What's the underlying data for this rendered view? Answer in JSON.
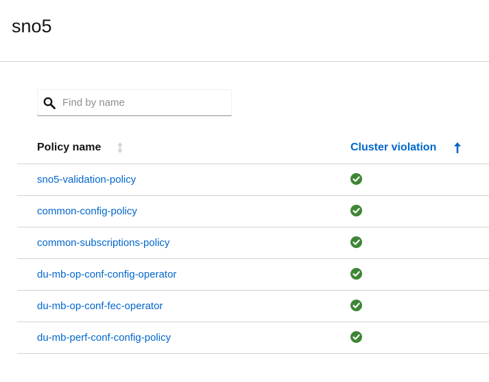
{
  "header": {
    "title": "sno5"
  },
  "search": {
    "placeholder": "Find by name",
    "value": ""
  },
  "table": {
    "columns": [
      {
        "label": "Policy name",
        "sorted": false,
        "sort_icon": "sort-both-icon"
      },
      {
        "label": "Cluster violation",
        "sorted": true,
        "sort_direction": "ascending",
        "sort_icon": "arrow-up-icon"
      }
    ],
    "rows": [
      {
        "policy_name": "sno5-validation-policy",
        "violation_status": "compliant",
        "status_icon": "check-circle-icon"
      },
      {
        "policy_name": "common-config-policy",
        "violation_status": "compliant",
        "status_icon": "check-circle-icon"
      },
      {
        "policy_name": "common-subscriptions-policy",
        "violation_status": "compliant",
        "status_icon": "check-circle-icon"
      },
      {
        "policy_name": "du-mb-op-conf-config-operator",
        "violation_status": "compliant",
        "status_icon": "check-circle-icon"
      },
      {
        "policy_name": "du-mb-op-conf-fec-operator",
        "violation_status": "compliant",
        "status_icon": "check-circle-icon"
      },
      {
        "policy_name": "du-mb-perf-conf-config-policy",
        "violation_status": "compliant",
        "status_icon": "check-circle-icon"
      }
    ]
  },
  "colors": {
    "link": "#0066cc",
    "success": "#3e8635",
    "border": "#d2d2d2",
    "text": "#151515"
  }
}
